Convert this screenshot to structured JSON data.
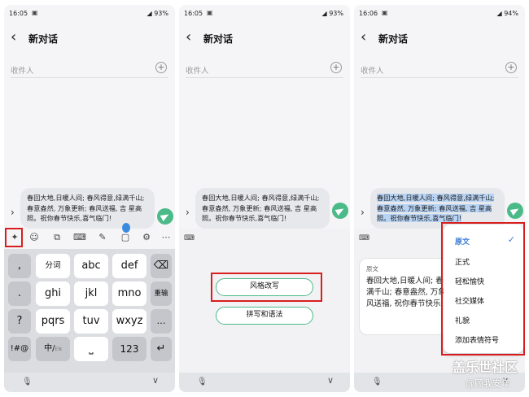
{
  "panels": [
    {
      "status": {
        "time": "16:05",
        "right": "93%"
      },
      "title": "新对话",
      "recipient_placeholder": "收件人",
      "message": "春回大地,日暖人间; 春风得意,绿满千山; 春意盎然, 万象更新; 春风送福, 吉 星高照。祝你春节快乐,喜气临门!",
      "keyboard": {
        "row1": [
          ",",
          "分词",
          "abc",
          "def",
          "⌫"
        ],
        "row2": [
          ".",
          "ghi",
          "jkl",
          "mno",
          "重输"
        ],
        "row3": [
          "?",
          "pqrs",
          "tuv",
          "wxyz",
          "…"
        ],
        "row4": [
          "!#@",
          "中/",
          "⎵",
          "123",
          "↵"
        ],
        "lang_sub": "EN"
      }
    },
    {
      "status": {
        "time": "16:05",
        "right": "93%"
      },
      "title": "新对话",
      "recipient_placeholder": "收件人",
      "message": "春回大地,日暖人间; 春风得意,绿满千山; 春意盎然, 万象更新; 春风送福, 吉 星高照。祝你春节快乐,喜气临门!",
      "buttons": {
        "style_rewrite": "风格改写",
        "spelling": "拼写和语法"
      }
    },
    {
      "status": {
        "time": "16:06",
        "right": "94%"
      },
      "title": "新对话",
      "recipient_placeholder": "收件人",
      "message": "春回大地,日暖人间; 春风得意,绿满千山; 春意盎然, 万象更新; 春风送福, 吉 星高照。祝你春节快乐,喜气临门!",
      "preview": {
        "label": "原文",
        "text": "春回大地,日暖人间; 春风得意,绿满千山; 春意盎然, 万象更新; 春风送福, 祝你春节快乐,喜气临门!"
      },
      "styles": [
        "原文",
        "正式",
        "轻松愉快",
        "社交媒体",
        "礼貌",
        "添加表情符号"
      ]
    }
  ],
  "watermark": {
    "line1": "盖乐世社区",
    "line2": "@顾我安年"
  },
  "colors": {
    "accent": "#4cba88",
    "highlight": "#d81e1e",
    "selected": "#3a7bd5"
  }
}
